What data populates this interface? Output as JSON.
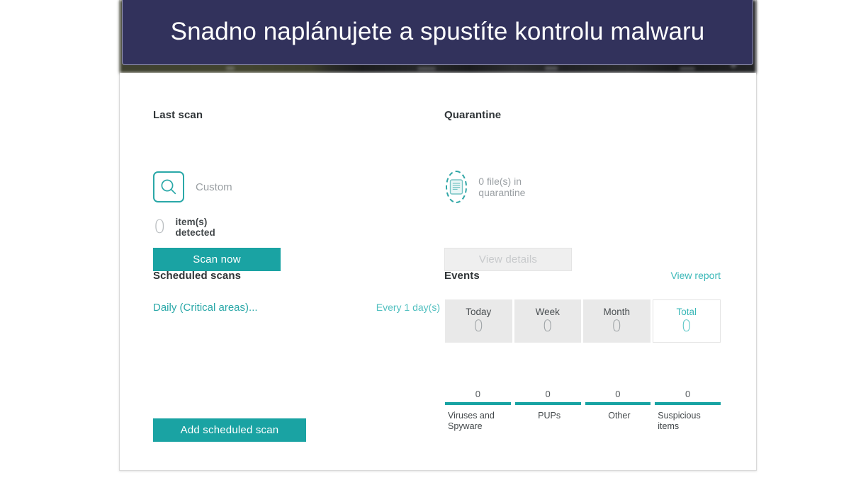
{
  "banner": {
    "headline": "Snadno naplánujete a spustíte kontrolu malwaru"
  },
  "app": {
    "last_scan": {
      "title": "Last scan",
      "scan_type_icon": "magnifier-icon",
      "scan_type": "Custom",
      "detected_count": "0",
      "detected_label": "item(s) detected",
      "scan_now_label": "Scan now"
    },
    "quarantine": {
      "title": "Quarantine",
      "icon": "quarantine-file-icon",
      "status": "0 file(s) in quarantine",
      "view_details_label": "View details"
    },
    "scheduled_scans": {
      "title": "Scheduled scans",
      "schedule_name": "Daily (Critical areas)...",
      "schedule_frequency": "Every 1 day(s)",
      "add_button_label": "Add scheduled scan"
    },
    "events": {
      "title": "Events",
      "view_report_label": "View report",
      "tabs": [
        {
          "label": "Today",
          "value": "0",
          "active": false
        },
        {
          "label": "Week",
          "value": "0",
          "active": false
        },
        {
          "label": "Month",
          "value": "0",
          "active": false
        },
        {
          "label": "Total",
          "value": "0",
          "active": true
        }
      ],
      "threat_stats": [
        {
          "count": "0",
          "name": "Viruses and Spyware"
        },
        {
          "count": "0",
          "name": "PUPs"
        },
        {
          "count": "0",
          "name": "Other"
        },
        {
          "count": "0",
          "name": "Suspicious items"
        }
      ]
    }
  },
  "colors": {
    "teal": "#1aa3a3",
    "teal_light": "#3bb8b8",
    "banner_navy": "#32325c",
    "tab_grey": "#e9e9e9"
  }
}
